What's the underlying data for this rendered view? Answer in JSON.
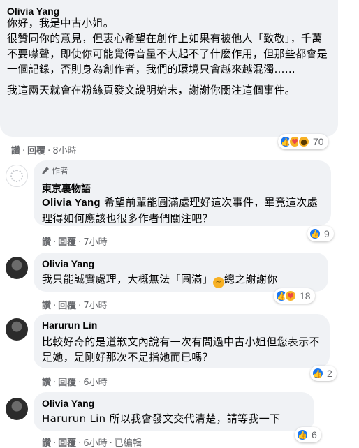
{
  "comments": [
    {
      "author": "Olivia Yang",
      "paragraphs": [
        "你好，我是中古小姐。",
        "很贊同你的意見，但衷心希望在創作上如果有被他人「致敬」，千萬不要噤聲，即使你可能覺得音量不大起不了什麼作用，但那些都會是一個記錄，否則身為創作者，我們的環境只會越來越混濁……",
        "我這兩天就會在粉絲頁發文說明始末，謝謝你關注這個事件。"
      ],
      "like_label": "讚",
      "reply_label": "回覆",
      "time": "8小時",
      "reactions": {
        "icons": [
          "like-icon",
          "care-icon",
          "wow-icon"
        ],
        "count": "70"
      }
    },
    {
      "badge": "作者",
      "author": "東京裏物語",
      "mention": "Olivia Yang",
      "text": " 希望前輩能圓滿處理好這次事件，畢竟這次處理得如何應該也很多作者們關注吧？",
      "like_label": "讚",
      "reply_label": "回覆",
      "time": "7小時",
      "reactions": {
        "icons": [
          "like-icon"
        ],
        "count": "9"
      }
    },
    {
      "author": "Olivia Yang",
      "text_before": "我只能誠實處理，大概無法「圓滿」",
      "text_after": "總之謝謝你",
      "like_label": "讚",
      "reply_label": "回覆",
      "time": "7小時",
      "reactions": {
        "icons": [
          "like-icon",
          "care-icon"
        ],
        "count": "18"
      }
    },
    {
      "author": "Harurun Lin",
      "text": "比較好奇的是道歉文內說有一次有問過中古小姐但您表示不是她，是剛好那次不是指她而已嗎？",
      "like_label": "讚",
      "reply_label": "回覆",
      "time": "6小時",
      "reactions": {
        "icons": [
          "like-icon"
        ],
        "count": "2"
      }
    },
    {
      "author": "Olivia Yang",
      "mention": "Harurun Lin",
      "text": " 所以我會發文交代清楚，請等我一下",
      "like_label": "讚",
      "reply_label": "回覆",
      "time": "6小時",
      "edited": "已編輯",
      "reactions": {
        "icons": [
          "like-icon"
        ],
        "count": "6"
      }
    }
  ],
  "colors": {
    "bubble": "#f0f2f5",
    "like": "#1877f2",
    "muted": "#65676b",
    "text": "#050505"
  }
}
